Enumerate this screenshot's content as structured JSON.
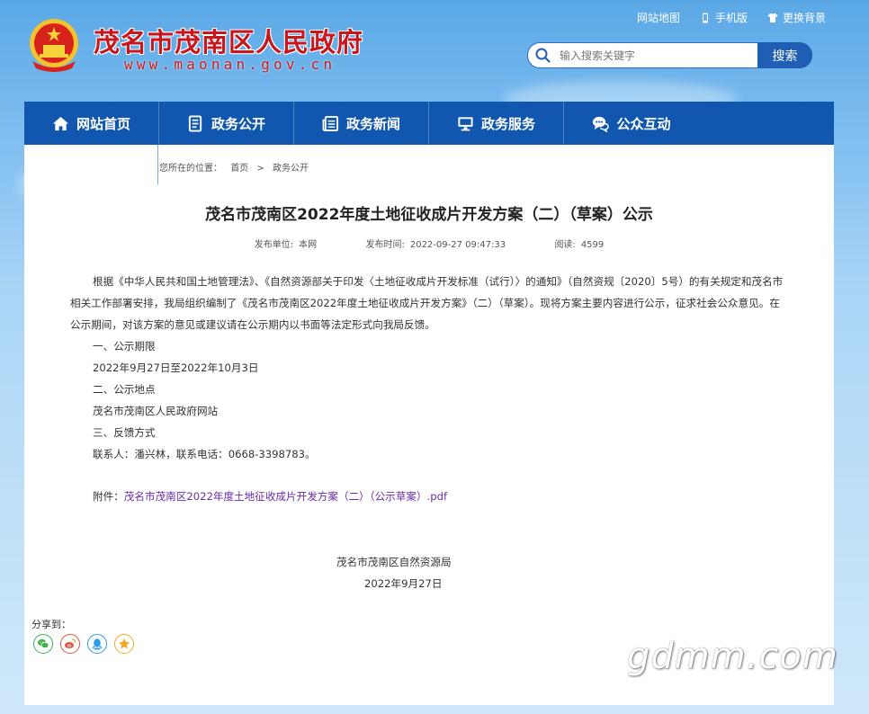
{
  "header": {
    "site_title": "茂名市茂南区人民政府",
    "site_url": "www.maonan.gov.cn",
    "top_links": [
      {
        "label": "网站地图",
        "icon": "none"
      },
      {
        "label": "手机版",
        "icon": "phone-icon"
      },
      {
        "label": "更换背景",
        "icon": "shirt-icon"
      }
    ],
    "search_placeholder": "输入搜索关键字",
    "search_button": "搜索"
  },
  "nav": [
    {
      "label": "网站首页",
      "icon": "home-icon"
    },
    {
      "label": "政务公开",
      "icon": "document-icon"
    },
    {
      "label": "政务新闻",
      "icon": "news-icon"
    },
    {
      "label": "政务服务",
      "icon": "monitor-icon"
    },
    {
      "label": "公众互动",
      "icon": "chat-icon"
    }
  ],
  "breadcrumb": {
    "prefix": "您所在的位置：",
    "items": [
      "首页",
      "政务公开"
    ],
    "separator": ">"
  },
  "article": {
    "title": "茂名市茂南区2022年度土地征收成片开发方案（二）（草案）公示",
    "meta": {
      "publisher_label": "发布单位:",
      "publisher": "本网",
      "time_label": "发布时间:",
      "time": "2022-09-27 09:47:33",
      "views_label": "阅读:",
      "views": "4599"
    },
    "intro": "根据《中华人民共和国土地管理法》、《自然资源部关于印发〈土地征收成片开发标准（试行）〉的通知》（自然资规〔2020〕5号）的有关规定和茂名市相关工作部署安排，我局组织编制了《茂名市茂南区2022年度土地征收成片开发方案》（二）（草案）。现将方案主要内容进行公示，征求社会公众意见。在公示期间，对该方案的意见或建议请在公示期内以书面等法定形式向我局反馈。",
    "lines": [
      "一、公示期限",
      "2022年9月27日至2022年10月3日",
      "二、公示地点",
      "茂名市茂南区人民政府网站",
      "三、反馈方式",
      "联系人：潘兴林，联系电话：0668-3398783。"
    ],
    "attachment_label": "附件：",
    "attachment_link": "茂名市茂南区2022年度土地征收成片开发方案（二）（公示草案）.pdf",
    "signature_org": "茂名市茂南区自然资源局",
    "signature_date": "2022年9月27日"
  },
  "share": {
    "label": "分享到：",
    "targets": [
      "wechat-icon",
      "weibo-icon",
      "qq-icon",
      "qzone-icon"
    ]
  },
  "watermark": "gdmm.com",
  "colors": {
    "brand_red": "#c8161d",
    "nav_blue": "#1157b0",
    "link_purple": "#6a2ca8"
  }
}
